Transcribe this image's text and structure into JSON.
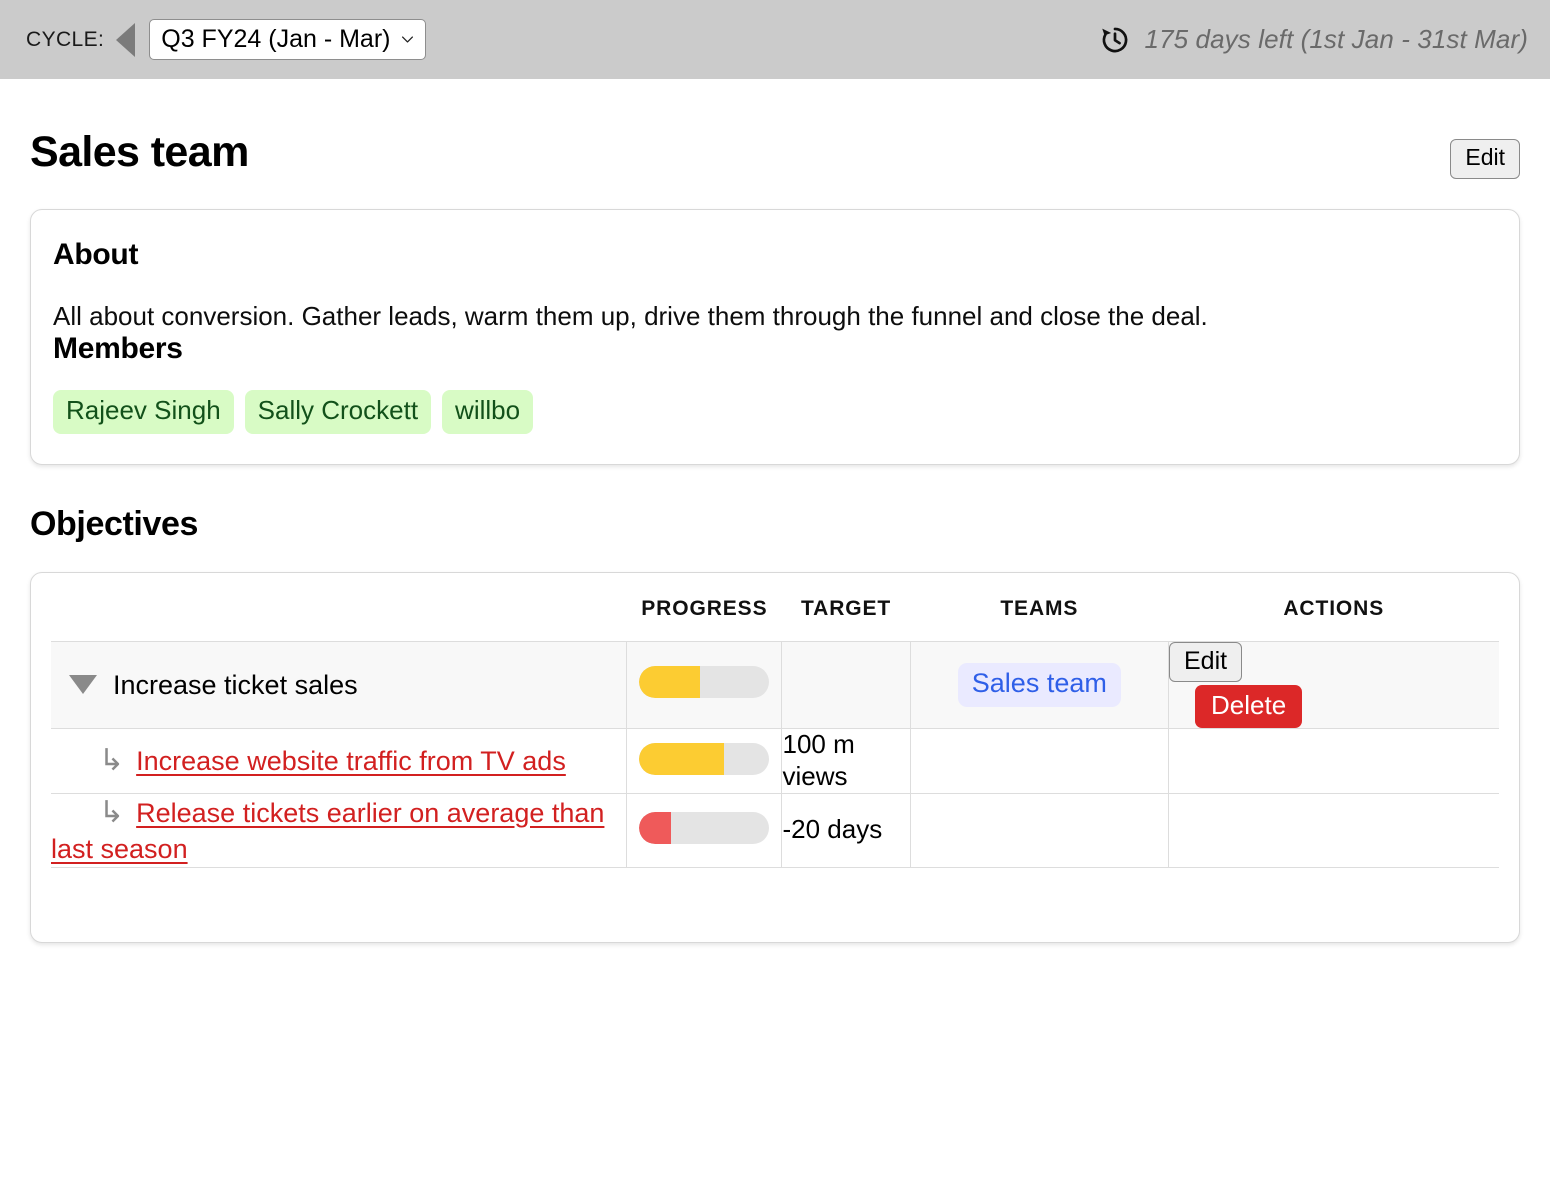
{
  "cycle_bar": {
    "label": "CYCLE:",
    "prev_icon": "triangle-left-icon",
    "selected_cycle": "Q3 FY24 (Jan - Mar)",
    "cycle_options": [
      "Q3 FY24 (Jan - Mar)"
    ],
    "history_icon": "clock-history-icon",
    "days_left": "175 days left (1st Jan - 31st Mar)"
  },
  "header": {
    "title": "Sales team",
    "edit_label": "Edit"
  },
  "about_card": {
    "about_heading": "About",
    "about_text": "All about conversion. Gather leads, warm them up, drive them through the funnel and close the deal.",
    "members_heading": "Members",
    "members": [
      "Rajeev Singh",
      "Sally Crockett",
      "willbo"
    ]
  },
  "objectives": {
    "title": "Objectives",
    "columns": {
      "name": "",
      "progress": "PROGRESS",
      "target": "TARGET",
      "teams": "TEAMS",
      "actions": "ACTIONS"
    },
    "rows": [
      {
        "type": "objective",
        "expand_icon": "caret-down-icon",
        "name": "Increase ticket sales",
        "progress_percent": 47,
        "progress_color": "#fccc32",
        "target": "",
        "teams": [
          "Sales team"
        ],
        "actions": {
          "edit_label": "Edit",
          "delete_label": "Delete"
        }
      },
      {
        "type": "key-result",
        "arrow_icon": "arrow-down-right-icon",
        "name": "Increase website traffic from TV ads",
        "progress_percent": 65,
        "progress_color": "#fccc32",
        "target": "100 m views",
        "teams": [],
        "actions": null
      },
      {
        "type": "key-result",
        "arrow_icon": "arrow-down-right-icon",
        "name": "Release tickets earlier on average than last season",
        "progress_percent": 24,
        "progress_color": "#ef5a5a",
        "target": "-20 days",
        "teams": [],
        "actions": null
      }
    ]
  },
  "colors": {
    "cycle_bar_bg": "#cbcbcb",
    "member_chip_bg": "#d8fbc5",
    "member_chip_text": "#12511a",
    "team_chip_bg": "#eaeaff",
    "team_chip_text": "#2f5fe8",
    "kr_link": "#d22020",
    "delete_button": "#dc2828",
    "progress_track": "#e4e4e4"
  }
}
